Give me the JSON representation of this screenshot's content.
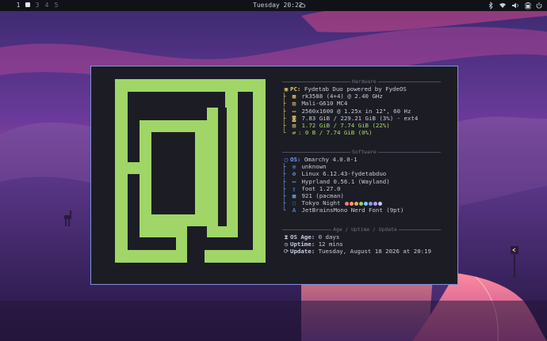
{
  "topbar": {
    "workspaces": [
      "1",
      "2",
      "3",
      "4",
      "5"
    ],
    "active_workspace": "2",
    "clock": "Tuesday 20:22",
    "weather_icon": "cloud-icon",
    "tray_icons": [
      "bluetooth-icon",
      "wifi-icon",
      "volume-icon",
      "battery-icon",
      "power-icon"
    ]
  },
  "fastfetch": {
    "hardware": {
      "title": "Hardware",
      "pc_label": "PC:",
      "pc_value": "Fydetab Duo powered by FydeOS",
      "rows": [
        {
          "icon": "cpu-icon",
          "value": "rk3588 (4+4) @ 2.40 GHz"
        },
        {
          "icon": "gpu-icon",
          "value": "Mali-G610 MC4"
        },
        {
          "icon": "display-icon",
          "value": "2560x1600 @ 1.25x in 12\", 60 Hz"
        },
        {
          "icon": "disk-icon",
          "value": "7.83 GiB / 229.21 GiB (3%) - ext4"
        },
        {
          "icon": "memory-icon",
          "value": "1.72 GiB / 7.74 GiB (22%)"
        },
        {
          "icon": "swap-icon",
          "value": ": 0 B / 7.74 GiB (0%)"
        }
      ]
    },
    "software": {
      "title": "Software",
      "os_label": "OS:",
      "os_value": "Omarchy 4.0.0-1",
      "rows": [
        {
          "icon": "linux-icon",
          "value": "unknown"
        },
        {
          "icon": "kernel-icon",
          "value": "Linux 6.12.43-fydetabduo"
        },
        {
          "icon": "window-manager-icon",
          "value": "Hyprland 0.56.1 (Wayland)"
        },
        {
          "icon": "terminal-icon",
          "value": "foot 1.27.0"
        },
        {
          "icon": "package-icon",
          "value": "921 (pacman)"
        },
        {
          "icon": "theme-icon",
          "value": "Tokyo Night"
        },
        {
          "icon": "font-icon",
          "value": "JetBrainsMono Nerd Font (9pt)"
        }
      ],
      "palette": [
        "#f7768e",
        "#ff9e64",
        "#e0af68",
        "#9ece6a",
        "#7dcfff",
        "#7aa2f7",
        "#bb9af7",
        "#c0caf5"
      ]
    },
    "age": {
      "title": "Age / Uptime / Update",
      "rows": [
        {
          "icon": "hourglass-icon",
          "label": "OS Age:",
          "value": "0 days"
        },
        {
          "icon": "uptime-icon",
          "label": "Uptime:",
          "value": "12 mins"
        },
        {
          "icon": "update-icon",
          "label": "Update:",
          "value": "Tuesday, August 18 2026 at 20:19"
        }
      ]
    }
  },
  "colors": {
    "terminal_bg": "#1c1d24",
    "terminal_border": "#7f93d6",
    "logo_green": "#9fd667",
    "hardware_accent": "#e4c96a",
    "software_accent": "#6fa3ff"
  }
}
